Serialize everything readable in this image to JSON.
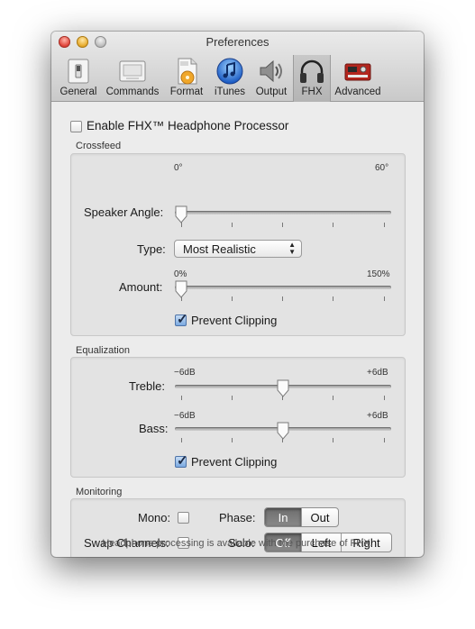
{
  "window": {
    "title": "Preferences"
  },
  "toolbar": {
    "items": [
      {
        "label": "General",
        "icon": "general-switch-icon"
      },
      {
        "label": "Commands",
        "icon": "commands-icon"
      },
      {
        "label": "Format",
        "icon": "format-caf-file-icon"
      },
      {
        "label": "iTunes",
        "icon": "itunes-icon"
      },
      {
        "label": "Output",
        "icon": "speaker-icon"
      },
      {
        "label": "FHX",
        "icon": "headphones-icon",
        "selected": true
      },
      {
        "label": "Advanced",
        "icon": "advanced-hardware-icon"
      }
    ]
  },
  "enable": {
    "label": "Enable FHX™ Headphone Processor",
    "checked": false
  },
  "crossfeed": {
    "title": "Crossfeed",
    "speaker_angle": {
      "label": "Speaker Angle:",
      "min_label": "0°",
      "max_label": "60°",
      "value": 0
    },
    "type": {
      "label": "Type:",
      "selected": "Most Realistic"
    },
    "amount": {
      "label": "Amount:",
      "min_label": "0%",
      "max_label": "150%",
      "value": 0
    },
    "prevent_clipping": {
      "label": "Prevent Clipping",
      "checked": true
    }
  },
  "equalization": {
    "title": "Equalization",
    "treble": {
      "label": "Treble:",
      "min_label": "−6dB",
      "max_label": "+6dB",
      "value": 0.5
    },
    "bass": {
      "label": "Bass:",
      "min_label": "−6dB",
      "max_label": "+6dB",
      "value": 0.5
    },
    "prevent_clipping": {
      "label": "Prevent Clipping",
      "checked": true
    }
  },
  "monitoring": {
    "title": "Monitoring",
    "mono": {
      "label": "Mono:",
      "checked": false
    },
    "swap": {
      "label": "Swap Channels:",
      "checked": false
    },
    "phase": {
      "label": "Phase:",
      "options": [
        "In",
        "Out"
      ],
      "selected": "In"
    },
    "solo": {
      "label": "Solo:",
      "options": [
        "Off",
        "Left",
        "Right"
      ],
      "selected": "Off"
    }
  },
  "footer": {
    "text": "Headphone processing is available with the purchase of FHX."
  }
}
